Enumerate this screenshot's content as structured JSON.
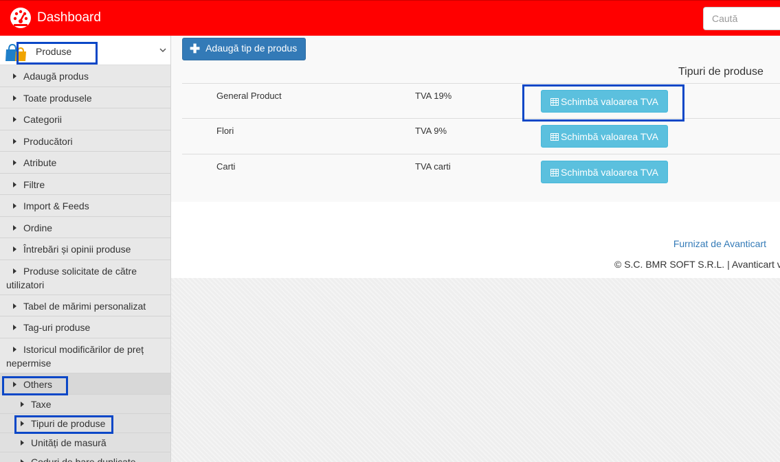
{
  "header": {
    "brand": "Dashboard",
    "brand_icon": "dashboard-gauge-icon",
    "search_placeholder": "Caută",
    "bg_color": "#ff0000"
  },
  "sidebar": {
    "section_title": "Produse",
    "section_icon": "shopping-bag-icon",
    "items": [
      {
        "label": "Adaugă produs"
      },
      {
        "label": "Toate produsele"
      },
      {
        "label": "Categorii"
      },
      {
        "label": "Producători"
      },
      {
        "label": "Atribute"
      },
      {
        "label": "Filtre"
      },
      {
        "label": "Import & Feeds"
      },
      {
        "label": "Ordine"
      },
      {
        "label": "Întrebări și opinii produse"
      },
      {
        "label": "Produse solicitate de către utilizatori"
      },
      {
        "label": "Tabel de mărimi personalizat"
      },
      {
        "label": "Tag-uri produse"
      },
      {
        "label": "Istoricul modificărilor de preț nepermise"
      },
      {
        "label": "Others"
      }
    ],
    "sub_items": [
      {
        "label": "Taxe"
      },
      {
        "label": "Tipuri de produse"
      },
      {
        "label": "Unități de masură"
      },
      {
        "label": "Coduri de bare duplicate"
      }
    ]
  },
  "main": {
    "add_button": "Adaugă tip de produs",
    "table_title": "Tipuri de produse",
    "rows": [
      {
        "name": "General Product",
        "vat": "TVA 19%",
        "action": "Schimbă valoarea TVA"
      },
      {
        "name": "Flori",
        "vat": "TVA 9%",
        "action": "Schimbă valoarea TVA"
      },
      {
        "name": "Carti",
        "vat": "TVA carti",
        "action": "Schimbă valoarea TVA"
      }
    ]
  },
  "footer": {
    "credit": "Furnizat de Avanticart",
    "copyright": "© S.C. BMR SOFT S.R.L. | Avanticart v"
  },
  "highlight_color": "#0a47c7"
}
